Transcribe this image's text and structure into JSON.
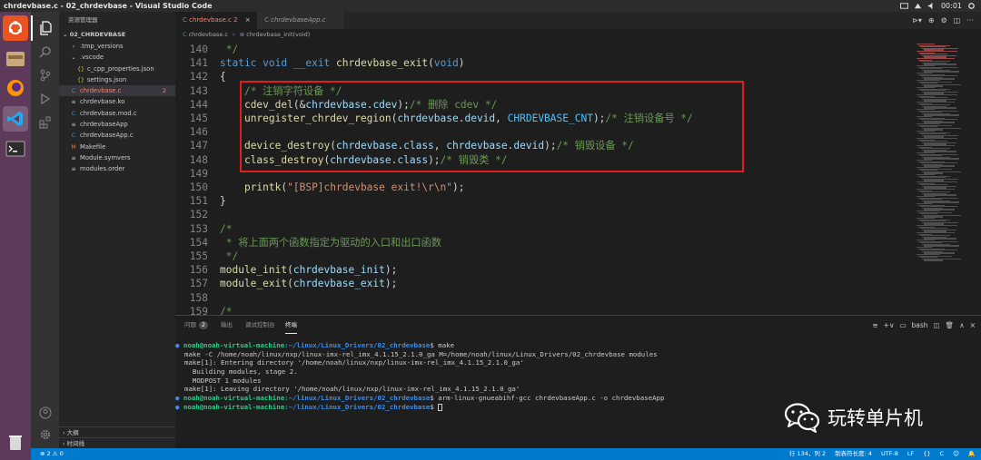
{
  "window_title": "chrdevbase.c - 02_chrdevbase - Visual Studio Code",
  "system_time": "00:01",
  "sidebar": {
    "header": "资源管理器",
    "project": "02_CHRDEVBASE",
    "items": [
      {
        "label": ".tmp_versions",
        "icon": "folder-closed",
        "indent": 1
      },
      {
        "label": ".vscode",
        "icon": "folder-open",
        "indent": 1
      },
      {
        "label": "c_cpp_properties.json",
        "icon": "json",
        "indent": 2
      },
      {
        "label": "settings.json",
        "icon": "json",
        "indent": 2
      },
      {
        "label": "chrdevbase.c",
        "icon": "c-file",
        "indent": 1,
        "badge": "2",
        "selected": true
      },
      {
        "label": "chrdevbase.ko",
        "icon": "file",
        "indent": 1
      },
      {
        "label": "chrdevbase.mod.c",
        "icon": "c-file",
        "indent": 1
      },
      {
        "label": "chrdevbaseApp",
        "icon": "file",
        "indent": 1
      },
      {
        "label": "chrdevbaseApp.c",
        "icon": "c-file",
        "indent": 1
      },
      {
        "label": "Makefile",
        "icon": "makefile",
        "indent": 1
      },
      {
        "label": "Module.symvers",
        "icon": "file",
        "indent": 1
      },
      {
        "label": "modules.order",
        "icon": "file",
        "indent": 1
      }
    ],
    "outline_label": "大纲",
    "timeline_label": "时间线"
  },
  "tabs": [
    {
      "label": "chrdevbase.c",
      "suffix": "2",
      "active": true
    },
    {
      "label": "chrdevbaseApp.c",
      "active": false
    }
  ],
  "breadcrumb": {
    "file": "chrdevbase.c",
    "symbol": "chrdevbase_init(void)"
  },
  "code_lines": [
    {
      "n": "140",
      "tokens": [
        [
          " */",
          "cm"
        ]
      ]
    },
    {
      "n": "141",
      "tokens": [
        [
          "static",
          "kw"
        ],
        [
          " ",
          "pu"
        ],
        [
          "void",
          "kw"
        ],
        [
          " ",
          "pu"
        ],
        [
          "__exit",
          "kw"
        ],
        [
          " ",
          "pu"
        ],
        [
          "chrdevbase_exit",
          "fn"
        ],
        [
          "(",
          "pu"
        ],
        [
          "void",
          "kw"
        ],
        [
          ")",
          "pu"
        ]
      ]
    },
    {
      "n": "142",
      "tokens": [
        [
          "{",
          "pu"
        ]
      ]
    },
    {
      "n": "143",
      "tokens": [
        [
          "    ",
          "pu"
        ],
        [
          "/* 注销字符设备 */",
          "cm"
        ]
      ]
    },
    {
      "n": "144",
      "tokens": [
        [
          "    ",
          "pu"
        ],
        [
          "cdev_del",
          "fn"
        ],
        [
          "(&",
          "pu"
        ],
        [
          "chrdevbase",
          "vr"
        ],
        [
          ".",
          "pu"
        ],
        [
          "cdev",
          "vr"
        ],
        [
          ");",
          "pu"
        ],
        [
          "/* 删除 cdev */",
          "cm"
        ]
      ]
    },
    {
      "n": "145",
      "tokens": [
        [
          "    ",
          "pu"
        ],
        [
          "unregister_chrdev_region",
          "fn"
        ],
        [
          "(",
          "pu"
        ],
        [
          "chrdevbase",
          "vr"
        ],
        [
          ".",
          "pu"
        ],
        [
          "devid",
          "vr"
        ],
        [
          ", ",
          "pu"
        ],
        [
          "CHRDEVBASE_CNT",
          "cn"
        ],
        [
          ");",
          "pu"
        ],
        [
          "/* 注销设备号 */",
          "cm"
        ]
      ]
    },
    {
      "n": "146",
      "tokens": []
    },
    {
      "n": "147",
      "tokens": [
        [
          "    ",
          "pu"
        ],
        [
          "device_destroy",
          "fn"
        ],
        [
          "(",
          "pu"
        ],
        [
          "chrdevbase",
          "vr"
        ],
        [
          ".",
          "pu"
        ],
        [
          "class",
          "vr"
        ],
        [
          ", ",
          "pu"
        ],
        [
          "chrdevbase",
          "vr"
        ],
        [
          ".",
          "pu"
        ],
        [
          "devid",
          "vr"
        ],
        [
          ");",
          "pu"
        ],
        [
          "/* 销毁设备 */",
          "cm"
        ]
      ]
    },
    {
      "n": "148",
      "tokens": [
        [
          "    ",
          "pu"
        ],
        [
          "class_destroy",
          "fn"
        ],
        [
          "(",
          "pu"
        ],
        [
          "chrdevbase",
          "vr"
        ],
        [
          ".",
          "pu"
        ],
        [
          "class",
          "vr"
        ],
        [
          ");",
          "pu"
        ],
        [
          "/* 销毁类 */",
          "cm"
        ]
      ]
    },
    {
      "n": "149",
      "tokens": []
    },
    {
      "n": "150",
      "tokens": [
        [
          "    ",
          "pu"
        ],
        [
          "printk",
          "fn"
        ],
        [
          "(",
          "pu"
        ],
        [
          "\"[BSP]chrdevbase exit!\\r\\n\"",
          "st"
        ],
        [
          ");",
          "pu"
        ]
      ]
    },
    {
      "n": "151",
      "tokens": [
        [
          "}",
          "pu"
        ]
      ]
    },
    {
      "n": "152",
      "tokens": []
    },
    {
      "n": "153",
      "tokens": [
        [
          "/*",
          "cm"
        ]
      ]
    },
    {
      "n": "154",
      "tokens": [
        [
          " * 将上面两个函数指定为驱动的入口和出口函数",
          "cm"
        ]
      ]
    },
    {
      "n": "155",
      "tokens": [
        [
          " */",
          "cm"
        ]
      ]
    },
    {
      "n": "156",
      "tokens": [
        [
          "module_init",
          "fn"
        ],
        [
          "(",
          "pu"
        ],
        [
          "chrdevbase_init",
          "vr"
        ],
        [
          ");",
          "pu"
        ]
      ]
    },
    {
      "n": "157",
      "tokens": [
        [
          "module_exit",
          "fn"
        ],
        [
          "(",
          "pu"
        ],
        [
          "chrdevbase_exit",
          "vr"
        ],
        [
          ");",
          "pu"
        ]
      ]
    },
    {
      "n": "158",
      "tokens": []
    },
    {
      "n": "159",
      "tokens": [
        [
          "/*",
          "cm"
        ]
      ]
    }
  ],
  "panel": {
    "tabs": [
      {
        "label": "问题",
        "badge": "2"
      },
      {
        "label": "输出"
      },
      {
        "label": "调试控制台"
      },
      {
        "label": "终端",
        "active": true
      }
    ],
    "shell": "bash"
  },
  "terminal_lines": [
    {
      "prompt": "noah@noah-virtual-machine",
      "path": ":~/linux/Linux_Drivers/02_chrdevbase",
      "cmd": "$ make"
    },
    {
      "text": "make -C /home/noah/linux/nxp/linux-imx-rel_imx_4.1.15_2.1.0_ga M=/home/noah/linux/Linux_Drivers/02_chrdevbase modules"
    },
    {
      "text": "make[1]: Entering directory '/home/noah/linux/nxp/linux-imx-rel_imx_4.1.15_2.1.0_ga'"
    },
    {
      "text": "  Building modules, stage 2."
    },
    {
      "text": "  MODPOST 1 modules"
    },
    {
      "text": "make[1]: Leaving directory '/home/noah/linux/nxp/linux-imx-rel_imx_4.1.15_2.1.0_ga'"
    },
    {
      "prompt": "noah@noah-virtual-machine",
      "path": ":~/linux/Linux_Drivers/02_chrdevbase",
      "cmd": "$ arm-linux-gnueabihf-gcc chrdevbaseApp.c -o chrdevbaseApp"
    },
    {
      "prompt": "noah@noah-virtual-machine",
      "path": ":~/linux/Linux_Drivers/02_chrdevbase",
      "cmd": "$ ",
      "cursor": true
    }
  ],
  "watermark": "玩转单片机",
  "statusbar": {
    "left": "⊗ 2 ⚠ 0",
    "position": "行 134，列 2",
    "tab_size": "制表符长度: 4",
    "encoding": "UTF-8",
    "eol": "LF",
    "language": "C"
  },
  "colors": {
    "accent": "#007acc",
    "highlight_box": "#e01e1e",
    "launcher": "#5e3a5a"
  }
}
